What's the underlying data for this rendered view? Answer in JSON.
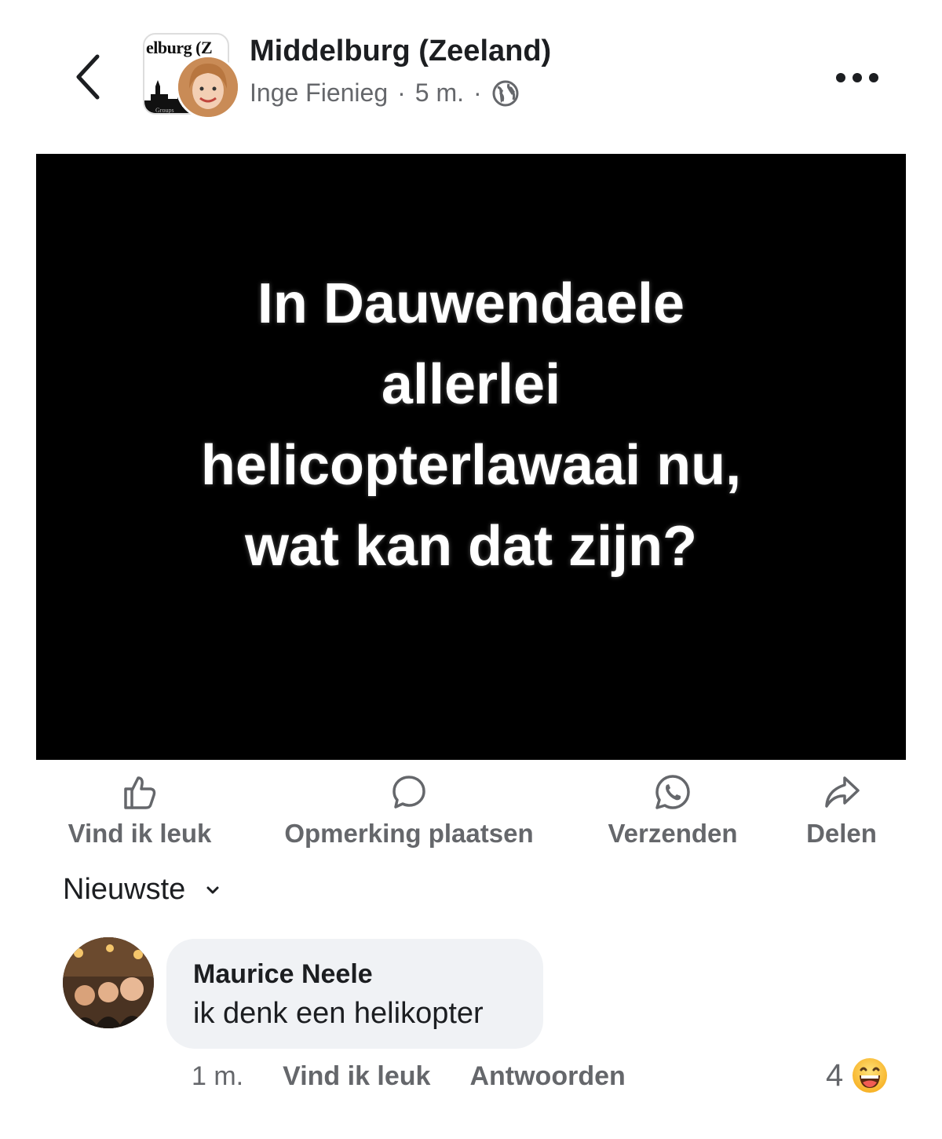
{
  "header": {
    "group_name": "Middelburg (Zeeland)",
    "group_avatar_text": "elburg (Z",
    "group_avatar_subtext": "Groups",
    "author": "Inge Fienieg",
    "time": "5 m.",
    "separator": "·",
    "visibility_icon": "globe-icon"
  },
  "post": {
    "text_lines": [
      "In Dauwendaele",
      "allerlei",
      "helicopterlawaai nu,",
      "wat kan dat zijn?"
    ],
    "background_color": "#000000"
  },
  "actions": {
    "like": "Vind ik leuk",
    "comment": "Opmerking plaatsen",
    "send": "Verzenden",
    "share": "Delen"
  },
  "comments_sort": {
    "label": "Nieuwste"
  },
  "comments": [
    {
      "author": "Maurice Neele",
      "text": "ik denk een helikopter",
      "time": "1 m.",
      "like_label": "Vind ik leuk",
      "reply_label": "Antwoorden",
      "reaction_count": "4",
      "reaction_icon": "laughing-emoji-icon"
    }
  ]
}
